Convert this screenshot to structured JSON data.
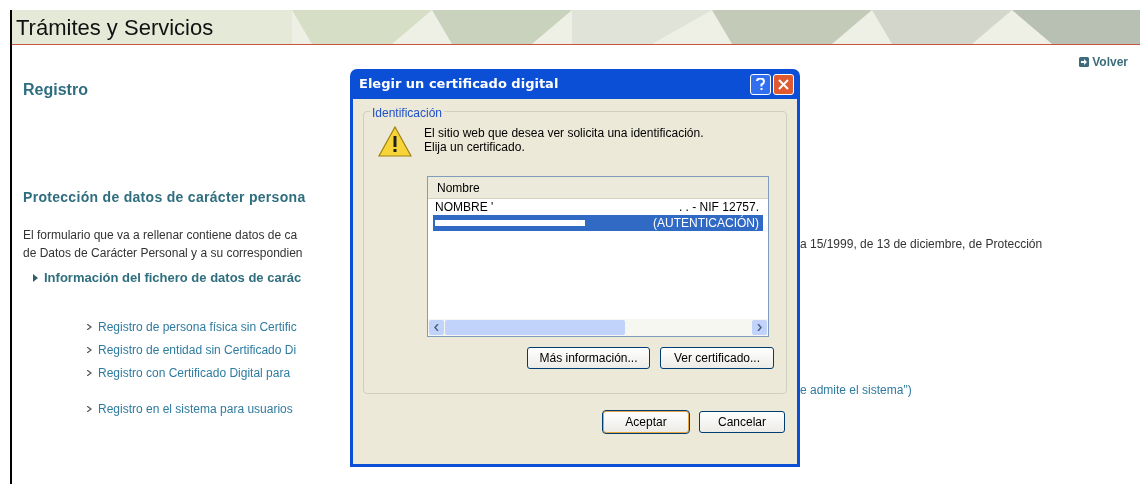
{
  "header": {
    "title": "Trámites y Servicios"
  },
  "page": {
    "back_link": "Volver",
    "heading": "Registro",
    "section_title": "Protección de datos de carácter persona",
    "paragraph_lines": [
      "El formulario que va a rellenar contiene datos de ca",
      "de Datos de Carácter Personal y a su correspondien"
    ],
    "info_link": "Información del fichero de datos de carác",
    "links": [
      "Registro de persona física sin Certific",
      "Registro de entidad sin Certificado Di",
      "Registro con Certificado Digital para"
    ],
    "last_link": "Registro en el sistema para usuarios",
    "right_fragments": {
      "paragraph": "a 15/1999, de 13 de diciembre, de Protección",
      "link": "e admite el sistema\")"
    }
  },
  "dialog": {
    "title": "Elegir un certificado digital",
    "group_label": "Identificación",
    "message_lines": [
      "El sitio web que desea ver solicita una identificación.",
      "Elija un certificado."
    ],
    "list": {
      "column": "Nombre",
      "rows": [
        {
          "start": "NOMBRE '",
          "end": ". . - NIF 12757.",
          "selected": false
        },
        {
          "start": "",
          "end": "(AUTENTICACIÓN)",
          "selected": true
        }
      ]
    },
    "buttons": [
      {
        "label": "Más información...",
        "default": false
      },
      {
        "label": "Ver certificado...",
        "default": false
      }
    ],
    "footer_buttons": [
      {
        "label": "Aceptar",
        "default": true
      },
      {
        "label": "Cancelar",
        "default": false
      }
    ]
  }
}
